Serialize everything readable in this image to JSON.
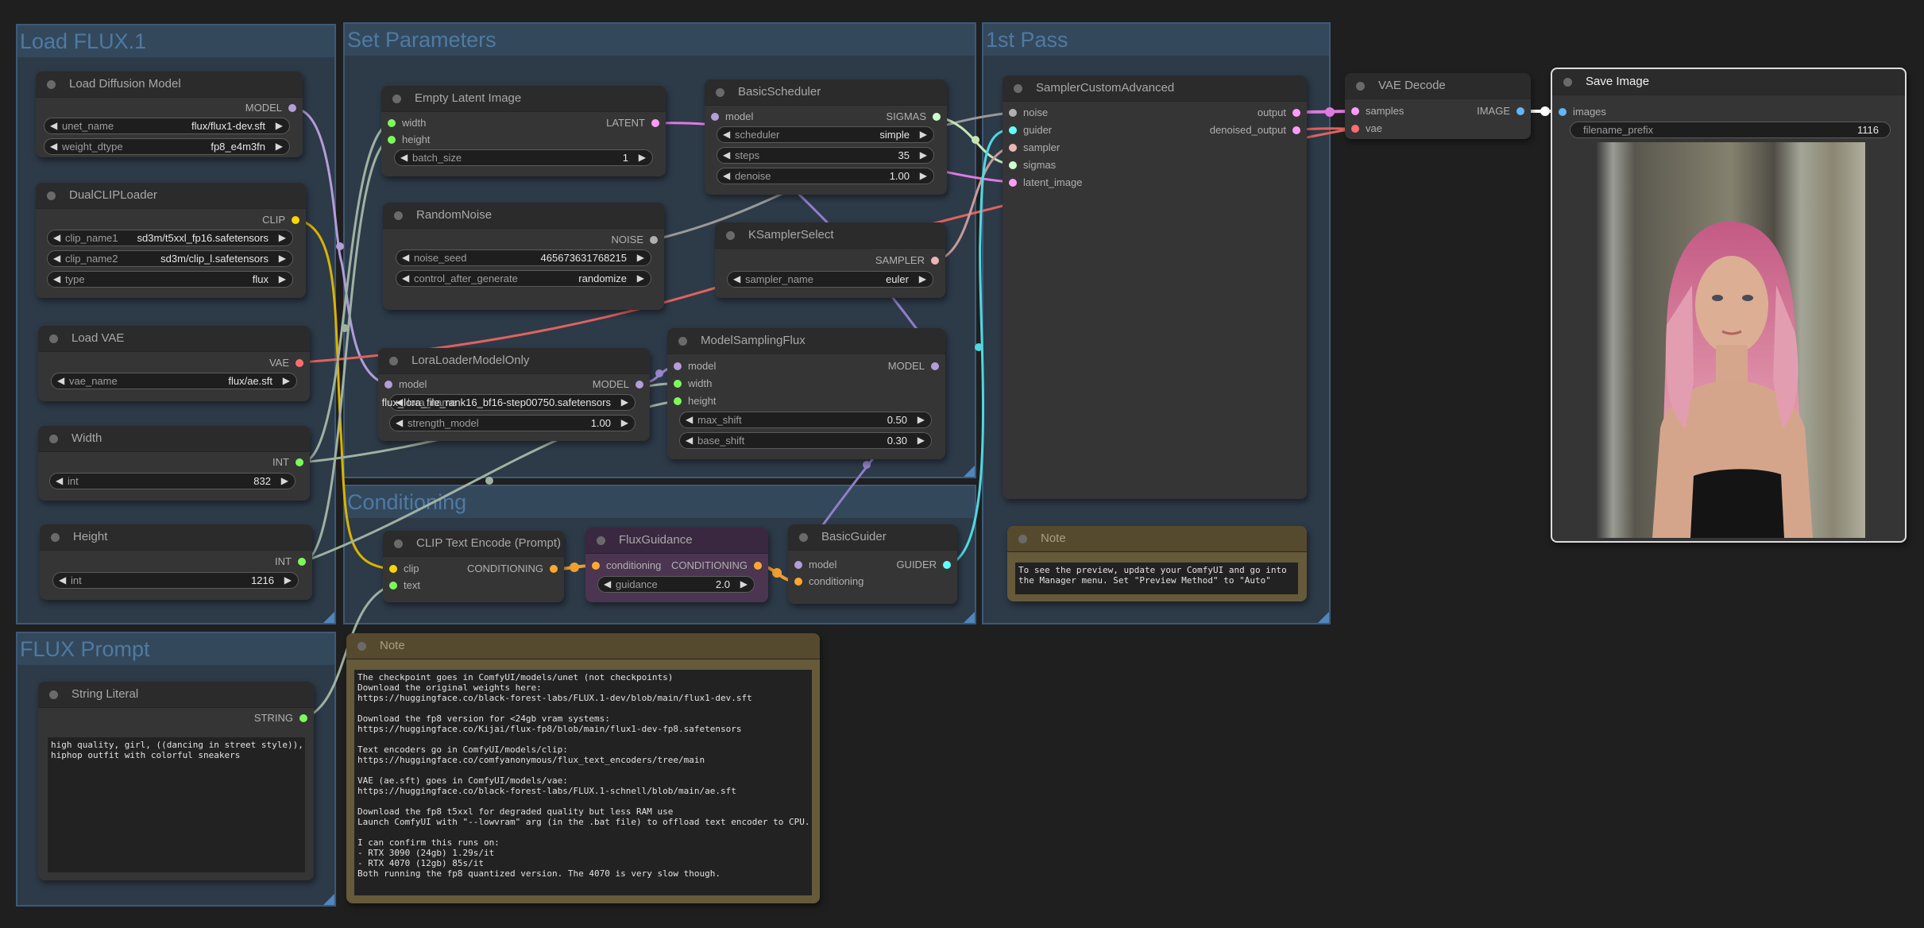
{
  "groups": {
    "load_flux": "Load FLUX.1",
    "set_parameters": "Set Parameters",
    "conditioning": "Conditioning",
    "first_pass": "1st Pass",
    "flux_prompt": "FLUX Prompt"
  },
  "nodes": {
    "load_diffusion_model": {
      "title": "Load Diffusion Model",
      "output": "MODEL",
      "widgets": [
        {
          "label": "unet_name",
          "value": "flux/flux1-dev.sft"
        },
        {
          "label": "weight_dtype",
          "value": "fp8_e4m3fn"
        }
      ]
    },
    "dual_clip_loader": {
      "title": "DualCLIPLoader",
      "output": "CLIP",
      "widgets": [
        {
          "label": "clip_name1",
          "value": "sd3m/t5xxl_fp16.safetensors"
        },
        {
          "label": "clip_name2",
          "value": "sd3m/clip_l.safetensors"
        },
        {
          "label": "type",
          "value": "flux"
        }
      ]
    },
    "load_vae": {
      "title": "Load VAE",
      "output": "VAE",
      "widgets": [
        {
          "label": "vae_name",
          "value": "flux/ae.sft"
        }
      ]
    },
    "width": {
      "title": "Width",
      "output": "INT",
      "widgets": [
        {
          "label": "int",
          "value": "832"
        }
      ]
    },
    "height": {
      "title": "Height",
      "output": "INT",
      "widgets": [
        {
          "label": "int",
          "value": "1216"
        }
      ]
    },
    "empty_latent": {
      "title": "Empty Latent Image",
      "inputs": [
        "width",
        "height"
      ],
      "output": "LATENT",
      "widgets": [
        {
          "label": "batch_size",
          "value": "1"
        }
      ]
    },
    "random_noise": {
      "title": "RandomNoise",
      "output": "NOISE",
      "widgets": [
        {
          "label": "noise_seed",
          "value": "465673631768215"
        },
        {
          "label": "control_after_generate",
          "value": "randomize"
        }
      ]
    },
    "lora_loader": {
      "title": "LoraLoaderModelOnly",
      "inputs": [
        "model"
      ],
      "output": "MODEL",
      "widgets": [
        {
          "label": "lora_name",
          "value": "flux_lora_file_rank16_bf16-step00750.safetensors"
        },
        {
          "label": "strength_model",
          "value": "1.00"
        }
      ]
    },
    "basic_scheduler": {
      "title": "BasicScheduler",
      "inputs": [
        "model"
      ],
      "output": "SIGMAS",
      "widgets": [
        {
          "label": "scheduler",
          "value": "simple"
        },
        {
          "label": "steps",
          "value": "35"
        },
        {
          "label": "denoise",
          "value": "1.00"
        }
      ]
    },
    "ksampler_select": {
      "title": "KSamplerSelect",
      "output": "SAMPLER",
      "widgets": [
        {
          "label": "sampler_name",
          "value": "euler"
        }
      ]
    },
    "model_sampling_flux": {
      "title": "ModelSamplingFlux",
      "inputs": [
        "model",
        "width",
        "height"
      ],
      "output": "MODEL",
      "widgets": [
        {
          "label": "max_shift",
          "value": "0.50"
        },
        {
          "label": "base_shift",
          "value": "0.30"
        }
      ]
    },
    "clip_text_encode": {
      "title": "CLIP Text Encode (Prompt)",
      "inputs": [
        "clip",
        "text"
      ],
      "output": "CONDITIONING"
    },
    "flux_guidance": {
      "title": "FluxGuidance",
      "inputs": [
        "conditioning"
      ],
      "output": "CONDITIONING",
      "widgets": [
        {
          "label": "guidance",
          "value": "2.0"
        }
      ]
    },
    "basic_guider": {
      "title": "BasicGuider",
      "inputs": [
        "model",
        "conditioning"
      ],
      "output": "GUIDER"
    },
    "sampler_custom_advanced": {
      "title": "SamplerCustomAdvanced",
      "inputs": [
        "noise",
        "guider",
        "sampler",
        "sigmas",
        "latent_image"
      ],
      "outputs": [
        "output",
        "denoised_output"
      ]
    },
    "note_preview": {
      "title": "Note",
      "text": "To see the preview, update your ComfyUI and go into\nthe Manager menu. Set \"Preview Method\" to \"Auto\""
    },
    "vae_decode": {
      "title": "VAE Decode",
      "inputs": [
        "samples",
        "vae"
      ],
      "output": "IMAGE"
    },
    "save_image": {
      "title": "Save Image",
      "inputs": [
        "images"
      ],
      "widgets": [
        {
          "label": "filename_prefix",
          "value": "1116"
        }
      ],
      "preview_description": "Generated portrait: woman with long pink hair, black top, neutral background"
    },
    "string_literal": {
      "title": "String Literal",
      "output": "STRING",
      "text": "high quality, girl, ((dancing in street style)),\nhiphop outfit with colorful sneakers"
    },
    "note_main": {
      "title": "Note",
      "text": "The checkpoint goes in ComfyUI/models/unet (not checkpoints)\nDownload the original weights here:\nhttps://huggingface.co/black-forest-labs/FLUX.1-dev/blob/main/flux1-dev.sft\n\nDownload the fp8 version for <24gb vram systems:\nhttps://huggingface.co/Kijai/flux-fp8/blob/main/flux1-dev-fp8.safetensors\n\nText encoders go in ComfyUI/models/clip:\nhttps://huggingface.co/comfyanonymous/flux_text_encoders/tree/main\n\nVAE (ae.sft) goes in ComfyUI/models/vae:\nhttps://huggingface.co/black-forest-labs/FLUX.1-schnell/blob/main/ae.sft\n\nDownload the fp8 t5xxl for degraded quality but less RAM use\nLaunch ComfyUI with \"--lowvram\" arg (in the .bat file) to offload text encoder to CPU.\n\nI can confirm this runs on:\n- RTX 3090 (24gb) 1.29s/it\n- RTX 4070 (12gb) 85s/it\nBoth running the fp8 quantized version. The 4070 is very slow though."
    }
  },
  "colors": {
    "model": "#b39ddb",
    "clip": "#ffd500",
    "vae": "#ff6e6e",
    "int": "#7cfa5a",
    "latent": "#ff9cf9",
    "noise": "#b0b0b0",
    "sigmas": "#cdffcd",
    "sampler": "#ecb4b4",
    "guider": "#66ffff",
    "conditioning": "#ffa931",
    "image": "#64b5f6",
    "string": "#7cfa5a"
  }
}
